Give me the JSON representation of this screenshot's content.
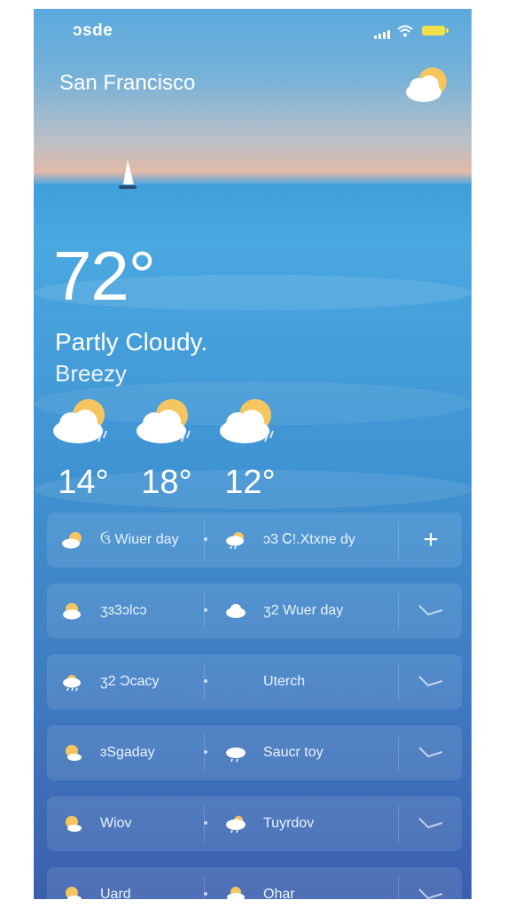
{
  "status_bar": {
    "time": "ɔsde",
    "battery_color": "#f1e24a"
  },
  "header": {
    "city": "San Francisco",
    "weather_icon": "partly-cloudy-icon"
  },
  "current": {
    "temperature": "72°",
    "condition": "Partly Cloudy.",
    "wind": "Breezy"
  },
  "hourly": [
    {
      "icon": "partly-cloudy-rain-icon",
      "temp": "14°"
    },
    {
      "icon": "partly-cloudy-rain-icon",
      "temp": "18°"
    },
    {
      "icon": "partly-cloudy-rain-icon",
      "temp": "12°"
    }
  ],
  "forecast_rows": [
    {
      "left_label": "ઉ Wiuer day",
      "right_label": "ɔ3 Ꮯ!.Xtxne dy",
      "action": "plus"
    },
    {
      "left_label": "ʒɜ3ɔlcɔ",
      "right_label": "ʒ2 Wuer day",
      "action": "chevron"
    },
    {
      "left_label": "ʒ2 Ɔcacy",
      "right_label": "Uterch",
      "action": "chevron"
    },
    {
      "left_label": "ɜSgaday",
      "right_label": "Saucr toy",
      "action": "chevron"
    },
    {
      "left_label": "Wiov",
      "right_label": "Tuyrdov",
      "action": "chevron"
    },
    {
      "left_label": "Uard",
      "right_label": "Ohar",
      "action": "chevron"
    }
  ],
  "colors": {
    "sky": "#5aa9de",
    "sunset": "#e3b9a8",
    "sea_top": "#4aa8e0",
    "sea_bottom": "#3b5fae",
    "sun": "#f5c560"
  }
}
